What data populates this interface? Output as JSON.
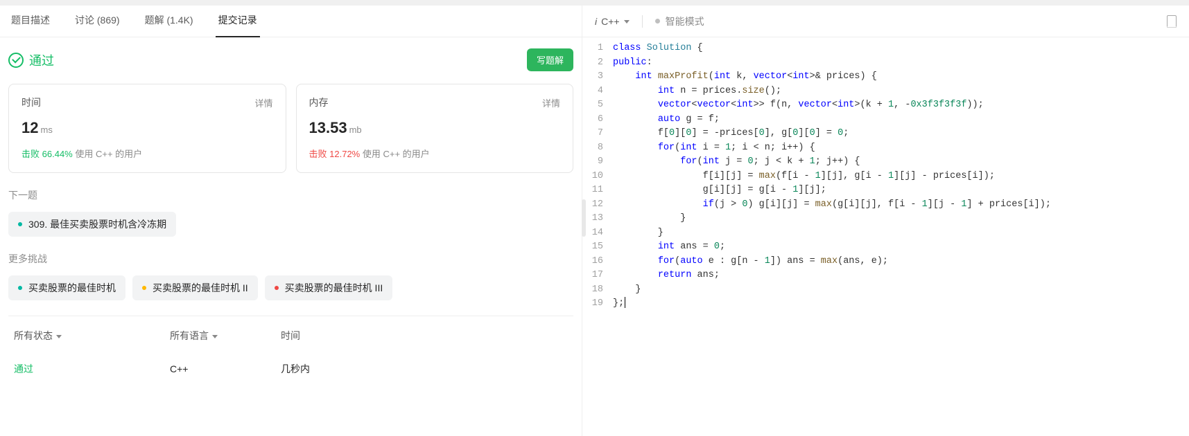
{
  "tabs": {
    "description": "题目描述",
    "discuss": "讨论 (869)",
    "solutions": "题解 (1.4K)",
    "submissions": "提交记录"
  },
  "result": {
    "status": "通过",
    "write_solution_btn": "写题解"
  },
  "cards": {
    "time": {
      "title": "时间",
      "detail": "详情",
      "value": "12",
      "unit": "ms",
      "beat_prefix": "击败",
      "beat_percent": "66.44%",
      "beat_suffix": "使用 C++ 的用户"
    },
    "memory": {
      "title": "内存",
      "detail": "详情",
      "value": "13.53",
      "unit": "mb",
      "beat_prefix": "击败",
      "beat_percent": "12.72%",
      "beat_suffix": "使用 C++ 的用户"
    }
  },
  "next": {
    "label": "下一题",
    "chip": "309. 最佳买卖股票时机含冷冻期"
  },
  "more": {
    "label": "更多挑战",
    "chips": [
      "买卖股票的最佳时机",
      "买卖股票的最佳时机 II",
      "买卖股票的最佳时机 III"
    ]
  },
  "filters": {
    "status": "所有状态",
    "lang": "所有语言",
    "time": "时间"
  },
  "submission_row": {
    "status": "通过",
    "lang": "C++",
    "time": "几秒内"
  },
  "editor": {
    "language": "C++",
    "mode": "智能模式",
    "code_lines": [
      "class Solution {",
      "public:",
      "    int maxProfit(int k, vector<int>& prices) {",
      "        int n = prices.size();",
      "        vector<vector<int>> f(n, vector<int>(k + 1, -0x3f3f3f3f));",
      "        auto g = f;",
      "        f[0][0] = -prices[0], g[0][0] = 0;",
      "        for(int i = 1; i < n; i++) {",
      "            for(int j = 0; j < k + 1; j++) {",
      "                f[i][j] = max(f[i - 1][j], g[i - 1][j] - prices[i]);",
      "                g[i][j] = g[i - 1][j];",
      "                if(j > 0) g[i][j] = max(g[i][j], f[i - 1][j - 1] + prices[i]);",
      "            }",
      "        }",
      "        int ans = 0;",
      "        for(auto e : g[n - 1]) ans = max(ans, e);",
      "        return ans;",
      "    }",
      "};"
    ]
  }
}
